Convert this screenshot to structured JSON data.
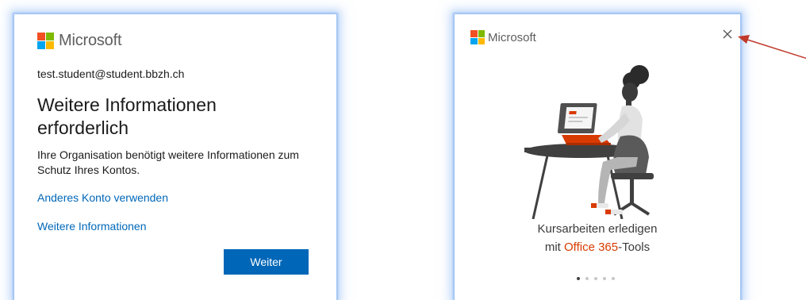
{
  "left_dialog": {
    "brand": "Microsoft",
    "account_email": "test.student@student.bbzh.ch",
    "title": "Weitere Informationen erforderlich",
    "description": "Ihre Organisation benötigt weitere Informationen zum Schutz Ihres Kontos.",
    "link_other_account": "Anderes Konto verwenden",
    "link_more_info": "Weitere Informationen",
    "next_button": "Weiter"
  },
  "right_dialog": {
    "brand": "Microsoft",
    "close_icon": "close-icon",
    "caption_line1": "Kursarbeiten erledigen",
    "caption_prefix": "mit ",
    "caption_highlight": "Office 365",
    "caption_suffix": "-Tools",
    "carousel_pages": 5,
    "carousel_active_index": 0
  },
  "colors": {
    "ms_red": "#f25022",
    "ms_green": "#7fba00",
    "ms_blue": "#00a4ef",
    "ms_yellow": "#ffb900",
    "link": "#0067b8",
    "button": "#0067b8",
    "office_orange": "#d83b01",
    "annotation_arrow": "#c0392b"
  }
}
